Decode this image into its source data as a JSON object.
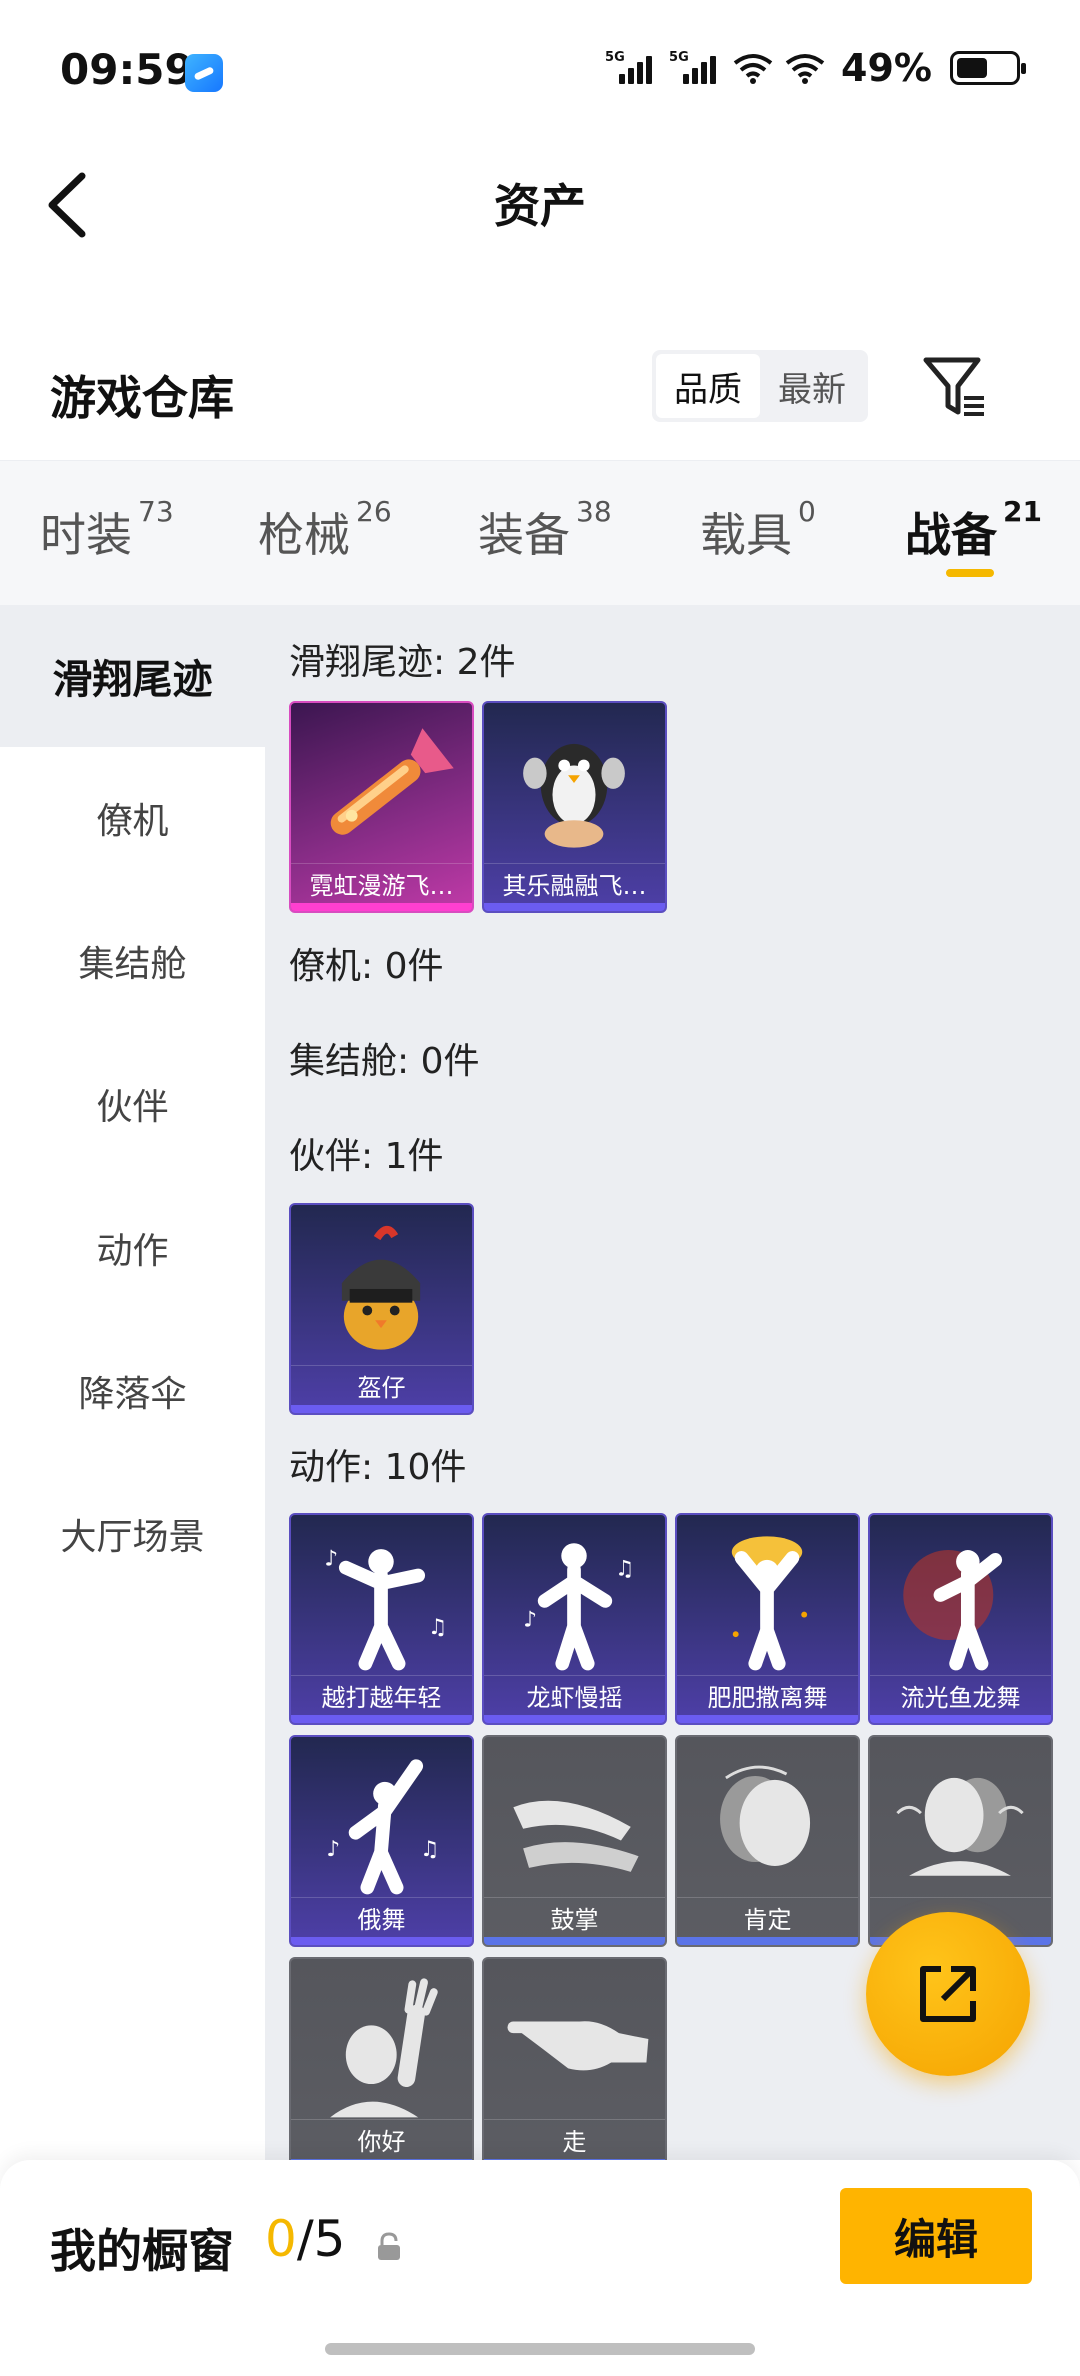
{
  "status_bar": {
    "time": "09:59",
    "network1": "5G",
    "network2": "5G",
    "battery_pct": "49%"
  },
  "nav": {
    "title": "资产"
  },
  "header": {
    "warehouse_title": "游戏仓库",
    "sort_options": [
      "品质",
      "最新"
    ],
    "active_sort": "品质"
  },
  "category_tabs": [
    {
      "label": "时装",
      "count": "73"
    },
    {
      "label": "枪械",
      "count": "26"
    },
    {
      "label": "装备",
      "count": "38"
    },
    {
      "label": "载具",
      "count": "0"
    },
    {
      "label": "战备",
      "count": "21"
    }
  ],
  "active_tab": "战备",
  "sidebar": [
    "滑翔尾迹",
    "僚机",
    "集结舱",
    "伙伴",
    "动作",
    "降落伞",
    "大厅场景"
  ],
  "sections": [
    {
      "title": "滑翔尾迹: 2件",
      "items": [
        {
          "name": "霓虹漫游飞…",
          "rarity": "pink",
          "icon": "glider-trail-icon"
        },
        {
          "name": "其乐融融飞…",
          "rarity": "purple",
          "icon": "penguin-trail-icon"
        }
      ]
    },
    {
      "title": "僚机: 0件",
      "items": []
    },
    {
      "title": "集结舱: 0件",
      "items": []
    },
    {
      "title": "伙伴: 1件",
      "items": [
        {
          "name": "盔仔",
          "rarity": "purple",
          "icon": "helmet-chick-icon"
        }
      ]
    },
    {
      "title": "动作: 10件",
      "items": [
        {
          "name": "越打越年轻",
          "rarity": "purple",
          "icon": "dance-pose-icon"
        },
        {
          "name": "龙虾慢摇",
          "rarity": "purple",
          "icon": "dance-pose-icon"
        },
        {
          "name": "肥肥撒离舞",
          "rarity": "purple",
          "icon": "dance-pose-icon"
        },
        {
          "name": "流光鱼龙舞",
          "rarity": "purple",
          "icon": "dance-pose-icon"
        },
        {
          "name": "俄舞",
          "rarity": "purple",
          "icon": "dance-pose-icon"
        },
        {
          "name": "鼓掌",
          "rarity": "gray",
          "icon": "clap-icon"
        },
        {
          "name": "肯定",
          "rarity": "gray",
          "icon": "nod-icon"
        },
        {
          "name": "",
          "rarity": "gray",
          "icon": "shake-head-icon"
        },
        {
          "name": "你好",
          "rarity": "gray",
          "icon": "wave-hello-icon"
        },
        {
          "name": "走",
          "rarity": "gray",
          "icon": "point-icon"
        }
      ]
    }
  ],
  "bottom_bar": {
    "showcase_label": "我的橱窗",
    "current": "0",
    "separator": "/",
    "max": "5",
    "edit_label": "编辑"
  },
  "colors": {
    "accent": "#f5b800",
    "content_bg": "#eceef2",
    "purple_card": "#3a3580",
    "pink_card": "#8a2d88",
    "gray_card": "#5c5d63"
  }
}
